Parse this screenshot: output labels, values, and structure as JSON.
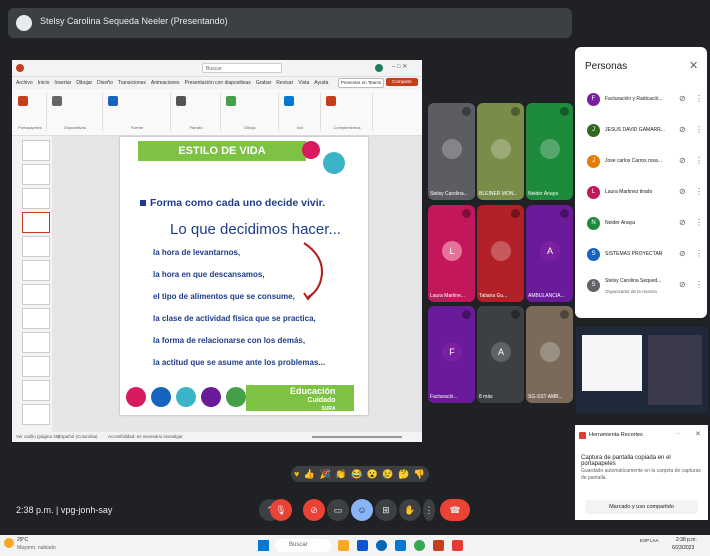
{
  "presenting": {
    "title": "Stelsy Carolina Sequeda Neeler (Presentando)"
  },
  "powerpoint": {
    "search_placeholder": "Buscar",
    "menu": [
      "Archivo",
      "Inicio",
      "Insertar",
      "Dibujar",
      "Diseño",
      "Transiciones",
      "Animaciones",
      "Presentación con diapositivas",
      "Grabar",
      "Revisar",
      "Vista",
      "Ayuda"
    ],
    "present_label": "Presentar en Teams",
    "share_label": "Compartir",
    "ribbon_groups": [
      "Portapapeles",
      "Diapositivas",
      "Fuente",
      "Párrafo",
      "Dibujo",
      "Voz",
      "Complementos"
    ],
    "status_left": "Ver carillo (página 25)",
    "status_mid": "Español (Colombia)",
    "status_acc": "Accesibilidad: es necesario investigar"
  },
  "slide": {
    "heading": "ESTILO DE VIDA",
    "bullet": "Forma como cada uno decide vivir.",
    "subheading": "Lo que decidimos hacer...",
    "lines": [
      "la hora de levantarnos,",
      "la hora en que descansamos,",
      "el tipo de alimentos que se consume,",
      "la clase de actividad física que se practica,",
      "la forma de relacionarse con los demás,",
      "la actitud que se asume ante los problemas..."
    ],
    "brand_line1": "Educación",
    "brand_line2": "Cuidado",
    "brand_line3": "SURA"
  },
  "tiles": [
    {
      "name": "Stelsy Carolina...",
      "color": "#5b5d63"
    },
    {
      "name": "BLEINER MON...",
      "color": "#7a8c4a"
    },
    {
      "name": "Neider Anaya",
      "color": "#1e8a3c"
    },
    {
      "name": "Laura Martine...",
      "initial": "L",
      "color": "#c2185b",
      "avatar": "#e57399"
    },
    {
      "name": "Tatiana Gu...",
      "color": "#b32028"
    },
    {
      "name": "AMBULANCIA...",
      "initial": "A",
      "color": "#6a1b9a",
      "avatar": "#7b1fa2"
    },
    {
      "name": "Facturació...",
      "initial": "F",
      "color": "#6a1b9a",
      "avatar": "#7b1fa2"
    },
    {
      "name": "8 más",
      "initial": "A",
      "color": "#3c4043",
      "avatar": "#5f6368"
    },
    {
      "name": "SG-SST AMB...",
      "color": "#7a6a5a"
    }
  ],
  "people": {
    "title": "Personas",
    "list": [
      {
        "name": "Facturación y Radicació...",
        "initial": "F",
        "color": "#7b1fa2"
      },
      {
        "name": "JESUS DAVID GAMARR...",
        "initial": "J",
        "color": "#33691e"
      },
      {
        "name": "Jose carlos Carros rosa...",
        "initial": "J",
        "color": "#e67c00"
      },
      {
        "name": "Laura Martinez tirado",
        "initial": "L",
        "color": "#c2185b"
      },
      {
        "name": "Neider Anaya",
        "initial": "N",
        "color": "#1e8a3c"
      },
      {
        "name": "SISTEMAS PROYECTAR",
        "initial": "S",
        "color": "#1565c0"
      },
      {
        "name": "Stelsy Carolina Sequed...",
        "sub": "Organizador de la reunión",
        "initial": "S",
        "color": "#5f6368"
      }
    ]
  },
  "notification": {
    "app": "Herramienta Recortes",
    "title": "Captura de pantalla copiada en el portapapeles",
    "body": "Guardado automáticamente en la carpeta de capturas de pantalla.",
    "action": "Marcado y uso compartido"
  },
  "meeting": {
    "time": "2:38 p.m.",
    "code": "vpg-jonh-say"
  },
  "taskbar": {
    "weather_temp": "29°C",
    "weather_desc": "Mayorm. nublado",
    "search": "Buscar",
    "clock_time": "2:38 p.m.",
    "clock_date": "6/23/2023",
    "lang": "ESP LAA"
  }
}
